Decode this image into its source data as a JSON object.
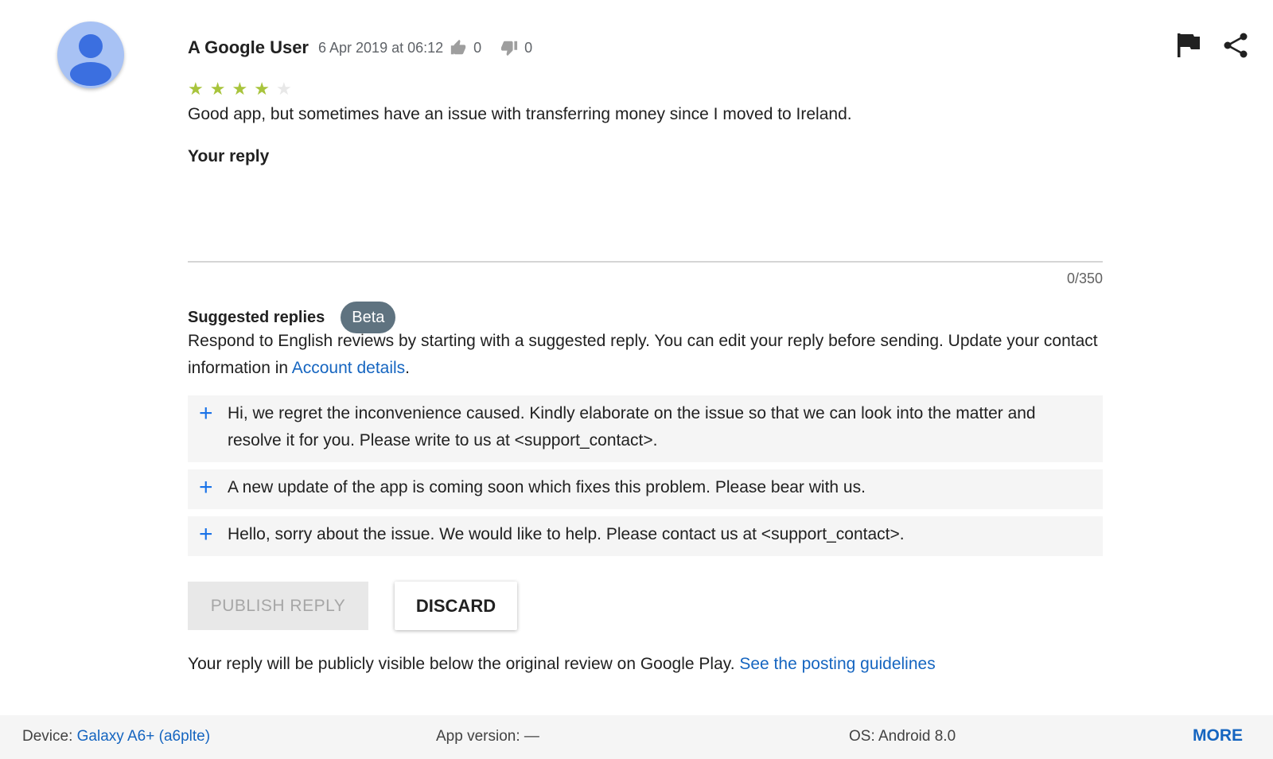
{
  "review": {
    "author": "A Google User",
    "date": "6 Apr 2019 at 06:12",
    "thumbs_up_count": "0",
    "thumbs_down_count": "0",
    "rating": 4,
    "rating_max": 5,
    "text": "Good app, but sometimes have an issue with transferring money since I moved to Ireland."
  },
  "icons": {
    "avatar": "person-avatar-icon",
    "thumbs_up": "thumbs-up-icon",
    "thumbs_down": "thumbs-down-icon",
    "flag": "flag-icon",
    "share": "share-icon",
    "star": "star-icon",
    "plus": "plus-icon"
  },
  "reply": {
    "heading": "Your reply",
    "value": "",
    "counter": "0/350"
  },
  "suggested": {
    "title": "Suggested replies",
    "badge": "Beta",
    "description_pre": "Respond to English reviews by starting with a suggested reply. You can edit your reply before sending. Update your contact information in ",
    "description_link": "Account details",
    "description_post": ".",
    "items": [
      "Hi, we regret the inconvenience caused. Kindly elaborate on the issue so that we can look into the matter and resolve it for you. Please write to us at <support_contact>.",
      "A new update of the app is coming soon which fixes this problem. Please bear with us.",
      "Hello, sorry about the issue. We would like to help. Please contact us at <support_contact>."
    ]
  },
  "buttons": {
    "publish": "PUBLISH REPLY",
    "discard": "DISCARD"
  },
  "note": {
    "text": "Your reply will be publicly visible below the original review on Google Play. ",
    "link": "See the posting guidelines"
  },
  "footer": {
    "device_label": "Device: ",
    "device_value": "Galaxy A6+ (a6plte)",
    "app_version": "App version: —",
    "os": "OS: Android 8.0",
    "more": "MORE"
  },
  "colors": {
    "star_filled": "#a8c43c",
    "link": "#1565c0",
    "badge_bg": "#5f7380",
    "avatar_bg": "#a8c2f4"
  }
}
